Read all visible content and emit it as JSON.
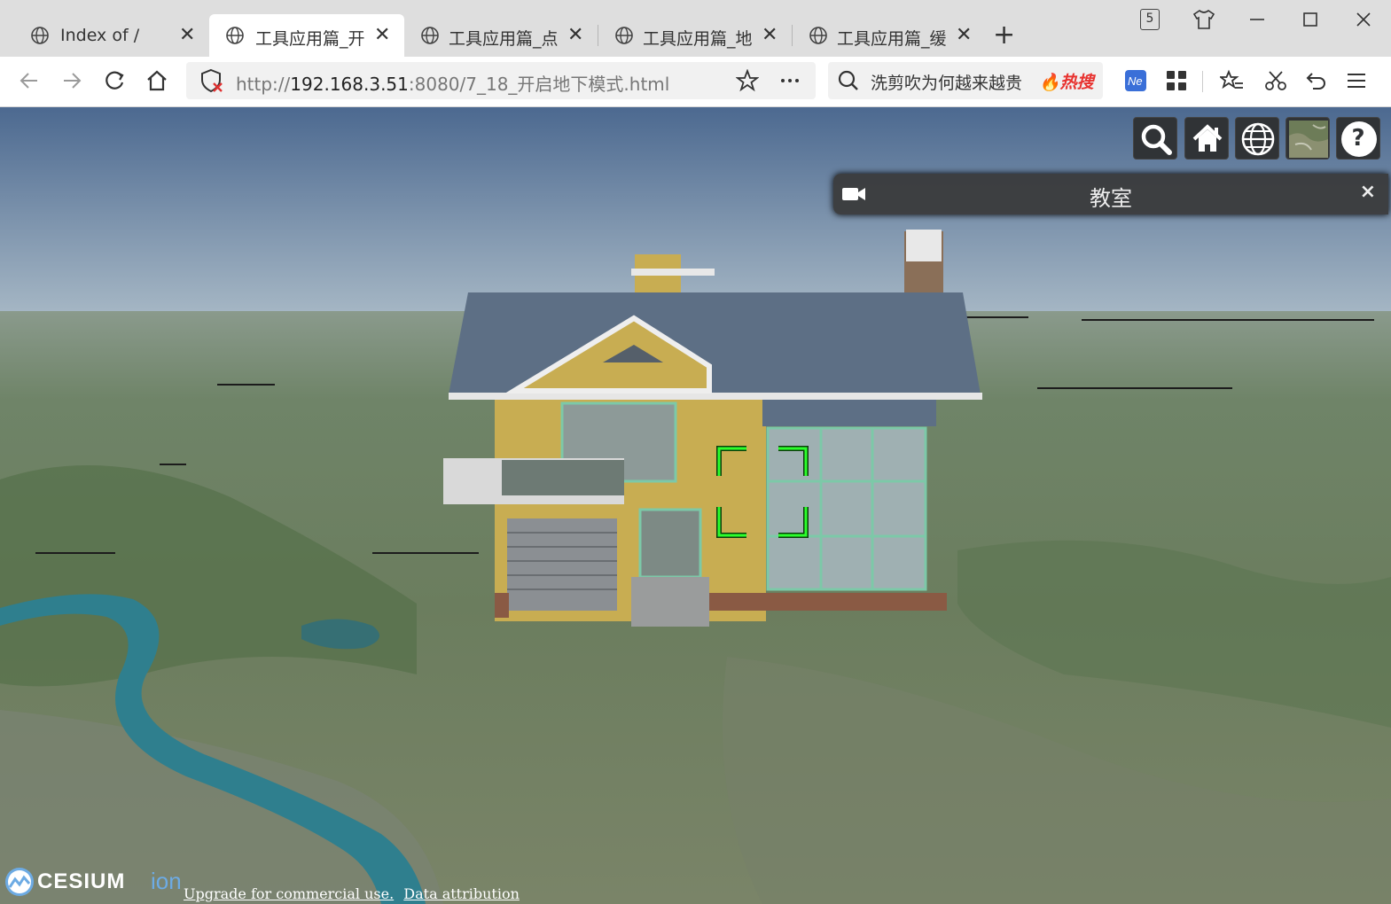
{
  "browser": {
    "tabs": [
      {
        "label": "Index of /",
        "active": false
      },
      {
        "label": "工具应用篇_开启",
        "active": true
      },
      {
        "label": "工具应用篇_点影",
        "active": false
      },
      {
        "label": "工具应用篇_地形",
        "active": false
      },
      {
        "label": "工具应用篇_缓冲",
        "active": false
      }
    ],
    "tab_count_badge": "5",
    "url": {
      "scheme": "http://",
      "host": "192.168.3.51",
      "path": ":8080/7_18_开启地下模式.html"
    },
    "search": {
      "text": "洗剪吹为何越来越贵",
      "hot_label": "热搜"
    }
  },
  "viewer": {
    "toolbar_icons": [
      "search-icon",
      "home-icon",
      "globe-icon",
      "imagery-layer-icon",
      "help-icon"
    ],
    "help_label": "?",
    "infobox": {
      "title": "教室",
      "close_label": "×"
    },
    "logo": {
      "brand": "CESIUM",
      "suffix": "ion"
    },
    "credits": [
      "Upgrade for commercial use.",
      "Data attribution"
    ]
  },
  "colors": {
    "tabbar_bg": "#dedede",
    "cesium_button_bg": "#303336",
    "selection_indicator": "#2bff2b",
    "hot_red": "#e8322f",
    "house_wall": "#c8ad52",
    "roof": "#5d6f85",
    "river": "#2f7f8e"
  }
}
